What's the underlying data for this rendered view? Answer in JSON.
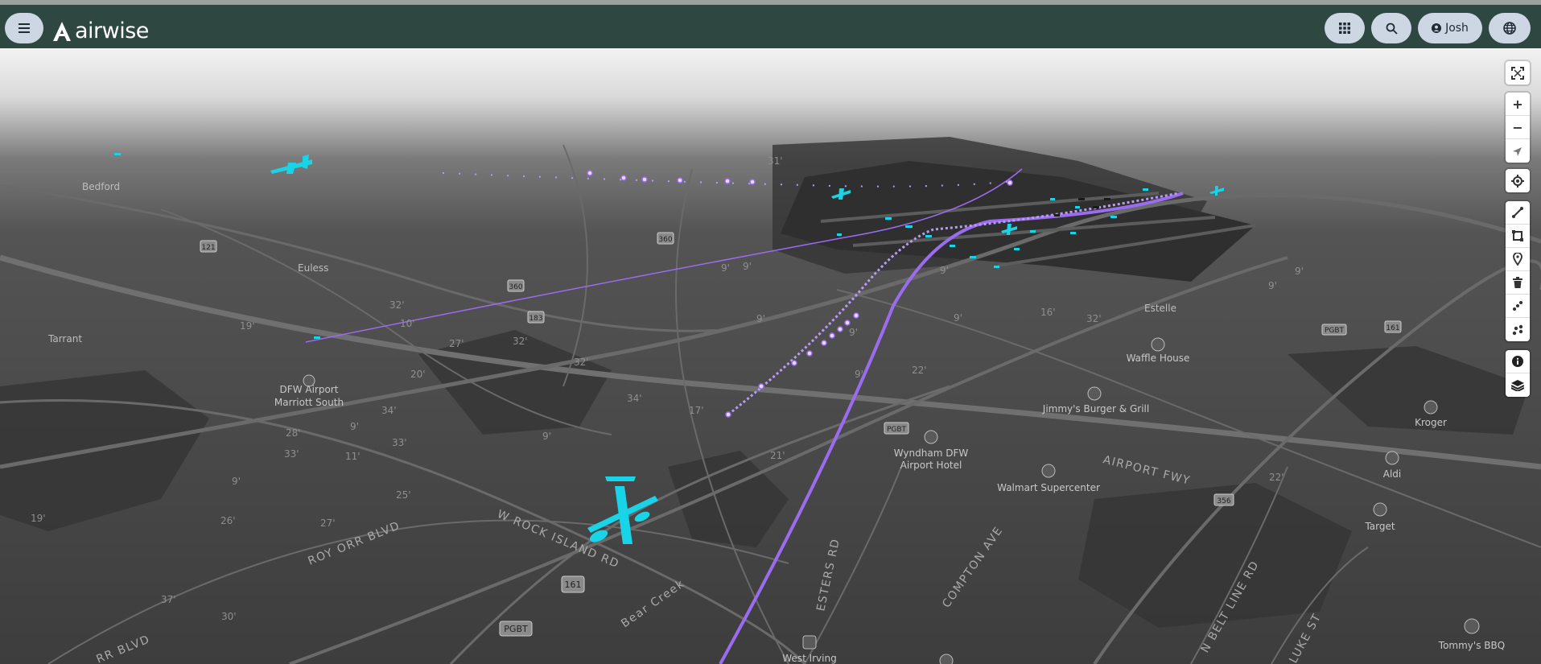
{
  "app": {
    "name": "airwise",
    "user": "Josh"
  },
  "colors": {
    "topbar": "#2e4740",
    "pill": "#cdd6e3",
    "aircraft": "#19d3e6",
    "track": "#9b6cf0"
  },
  "icons": {
    "menu": "menu-icon",
    "apps": "grid-icon",
    "search": "search-icon",
    "user": "user-icon",
    "globe": "globe-icon"
  },
  "map": {
    "places": {
      "bedford": "Bedford",
      "euless": "Euless",
      "tarrant": "Tarrant",
      "estelle": "Estelle"
    },
    "pois": {
      "dfw_marriott": [
        "DFW Airport",
        "Marriott South"
      ],
      "waffle_house": "Waffle House",
      "jimmys": "Jimmy's Burger & Grill",
      "wyndham": [
        "Wyndham DFW",
        "Airport Hotel"
      ],
      "walmart": "Walmart Supercenter",
      "kroger": "Kroger",
      "aldi": "Aldi",
      "target": "Target",
      "tommys": "Tommy's BBQ",
      "west_irving": "West Irving"
    },
    "roads": {
      "airport_fwy": "AIRPORT FWY",
      "rock_island": "W ROCK ISLAND RD",
      "roy_orr": "ROY ORR BLVD",
      "orr_blvd": "RR BLVD",
      "esters": "ESTERS RD",
      "compton": "COMPTON AVE",
      "belt_line": "N BELT LINE RD",
      "luke": "LUKE ST",
      "bear_creek": "Bear Creek"
    },
    "shields": {
      "s121": "121",
      "s360a": "360",
      "s360b": "360",
      "s183": "183",
      "s161a": "161",
      "s161b": "161",
      "s356": "356",
      "pgbt1": "PGBT",
      "pgbt2": "PGBT",
      "pgbt3": "PGBT"
    },
    "elevations": [
      "31'",
      "19'",
      "32'",
      "10'",
      "27'",
      "32'",
      "20'",
      "32'",
      "34'",
      "9'",
      "28'",
      "33'",
      "11'",
      "34'",
      "33'",
      "9'",
      "17'",
      "21'",
      "25'",
      "9'",
      "26'",
      "27'",
      "19'",
      "37'",
      "30'",
      "9'",
      "9'",
      "9'",
      "9'",
      "9'",
      "22'",
      "16'",
      "32'",
      "9'",
      "9'",
      "22'",
      "9'",
      "9'"
    ]
  }
}
